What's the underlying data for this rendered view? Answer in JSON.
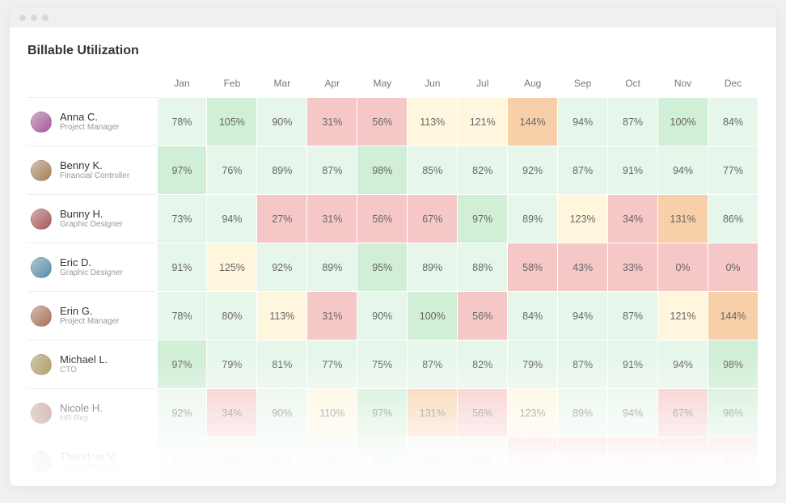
{
  "title": "Billable Utilization",
  "months": [
    "Jan",
    "Feb",
    "Mar",
    "Apr",
    "May",
    "Jun",
    "Jul",
    "Aug",
    "Sep",
    "Oct",
    "Nov",
    "Dec"
  ],
  "people": [
    {
      "name": "Anna C.",
      "role": "Project Manager",
      "avatar_hue": 310
    },
    {
      "name": "Benny K.",
      "role": "Financial Controller",
      "avatar_hue": 30
    },
    {
      "name": "Bunny H.",
      "role": "Graphic Designer",
      "avatar_hue": 0
    },
    {
      "name": "Eric D.",
      "role": "Graphic Designer",
      "avatar_hue": 200
    },
    {
      "name": "Erin G.",
      "role": "Project Manager",
      "avatar_hue": 20
    },
    {
      "name": "Michael L.",
      "role": "CTO",
      "avatar_hue": 45
    },
    {
      "name": "Nicole H.",
      "role": "HR Rep",
      "avatar_hue": 15
    },
    {
      "name": "Theodore V.",
      "role": "Junior Developer",
      "avatar_hue": 90
    }
  ],
  "chart_data": {
    "type": "heatmap",
    "title": "Billable Utilization",
    "xlabel": "",
    "ylabel": "",
    "categories": [
      "Jan",
      "Feb",
      "Mar",
      "Apr",
      "May",
      "Jun",
      "Jul",
      "Aug",
      "Sep",
      "Oct",
      "Nov",
      "Dec"
    ],
    "series": [
      {
        "name": "Anna C.",
        "values": [
          78,
          105,
          90,
          31,
          56,
          113,
          121,
          144,
          94,
          87,
          100,
          84
        ]
      },
      {
        "name": "Benny K.",
        "values": [
          97,
          76,
          89,
          87,
          98,
          85,
          82,
          92,
          87,
          91,
          94,
          77
        ]
      },
      {
        "name": "Bunny H.",
        "values": [
          73,
          94,
          27,
          31,
          56,
          67,
          97,
          89,
          123,
          34,
          131,
          86
        ]
      },
      {
        "name": "Eric D.",
        "values": [
          91,
          125,
          92,
          89,
          95,
          89,
          88,
          58,
          43,
          33,
          0,
          0
        ]
      },
      {
        "name": "Erin G.",
        "values": [
          78,
          80,
          113,
          31,
          90,
          100,
          56,
          84,
          94,
          87,
          121,
          144
        ]
      },
      {
        "name": "Michael L.",
        "values": [
          97,
          79,
          81,
          77,
          75,
          87,
          82,
          79,
          87,
          91,
          94,
          98
        ]
      },
      {
        "name": "Nicole H.",
        "values": [
          92,
          34,
          90,
          110,
          97,
          131,
          56,
          123,
          89,
          94,
          67,
          96
        ]
      },
      {
        "name": "Theodore V.",
        "values": [
          91,
          76,
          92,
          89,
          95,
          89,
          88,
          58,
          43,
          33,
          0,
          0
        ]
      }
    ],
    "unit": "%",
    "color_scale": {
      "low": {
        "threshold_max": 69,
        "color": "#f6c7c7"
      },
      "mid": {
        "threshold_min": 70,
        "threshold_max": 109,
        "color": "#d8f2dd"
      },
      "high": {
        "threshold_min": 110,
        "color": "#f9dfc2"
      },
      "near_mid": {
        "color": "#fff6de"
      }
    }
  }
}
